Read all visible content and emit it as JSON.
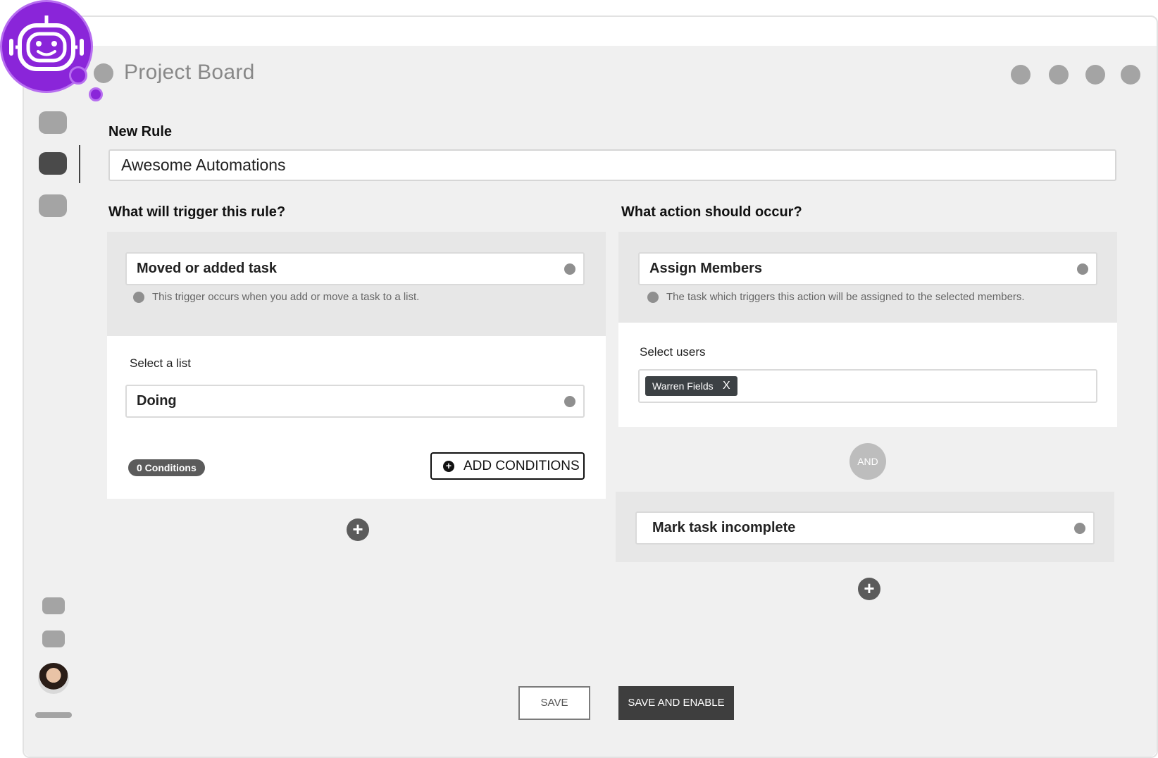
{
  "header": {
    "title": "Project Board"
  },
  "form": {
    "section_label": "New Rule",
    "rule_name": "Awesome Automations",
    "trigger": {
      "heading": "What will trigger this rule?",
      "type": "Moved or added task",
      "hint": "This trigger occurs when you add or move a task to a list.",
      "list_label": "Select a list",
      "list_value": "Doing",
      "conditions_badge": "0 Conditions",
      "add_conditions_label": "ADD CONDITIONS"
    },
    "action": {
      "heading": "What action should occur?",
      "type": "Assign Members",
      "hint": "The task which triggers this action will be assigned to the selected members.",
      "users_label": "Select users",
      "selected_user": "Warren Fields",
      "chip_remove": "X",
      "and_label": "AND",
      "second_action": "Mark task incomplete"
    },
    "buttons": {
      "save": "SAVE",
      "save_enable": "SAVE AND ENABLE"
    }
  },
  "icons": {
    "plus": "+",
    "add_conditions": "+"
  },
  "colors": {
    "bot_purple": "#8a25d9",
    "chip_bg": "#3c4144",
    "primary_button": "#3e3e3e"
  }
}
